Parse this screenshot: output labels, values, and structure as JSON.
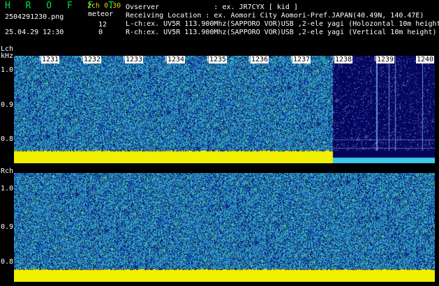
{
  "app": {
    "title": "H R O F F T",
    "mode": "2ch 0.30",
    "filename": "2504291230.png",
    "datetime": "25.04.29 12:30",
    "meteor_label": "meteor",
    "meteor_count_l": "12",
    "meteor_count_r": "0"
  },
  "info": {
    "observer": "Ovserver             : ex. JR7CYX [ kid ]",
    "location": "Receiving Location : ex. Aomori City Aomori-Pref.JAPAN(40.49N, 140.47E)",
    "lch": "L-ch:ex. UV5R 113.900Mhz(SAPPORO VOR)USB ,2-ele yagi (Holozontal 10m height)",
    "rch": "R-ch:ex. UV5R 113.900Mhz(SAPPORO VOR)USB ,2-ele yagi (Vertical 10m height)"
  },
  "panels": {
    "left": {
      "label": "Lch",
      "unit": "kHz",
      "y_ticks": [
        "1.0",
        "0.9",
        "0.8"
      ],
      "x_ticks": [
        "1231",
        "1232",
        "1233",
        "1234",
        "1235",
        "1236",
        "1237",
        "1238",
        "1239",
        "1240"
      ],
      "dark_fraction": 0.242
    },
    "right": {
      "label": "Rch",
      "y_ticks": [
        "1.0",
        "0.9",
        "0.8"
      ]
    }
  },
  "colors": {
    "noise_dark": "#0a1a70",
    "noise_mid": "#1f6fd0",
    "noise_light": "#32c0c0",
    "noise_green": "#60d080",
    "baseline": "#f0f000",
    "dark_region": "#05055a"
  }
}
